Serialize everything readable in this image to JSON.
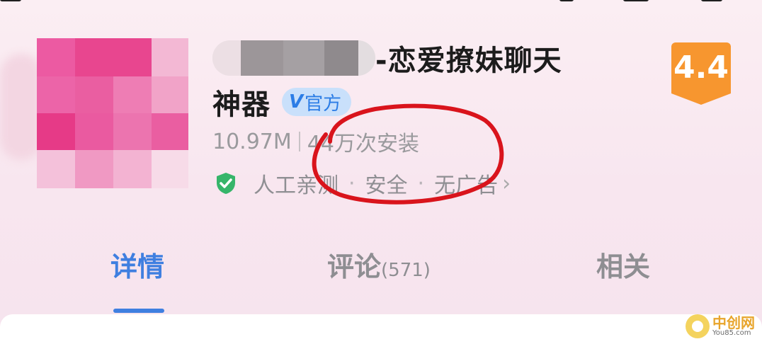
{
  "app": {
    "name_line1": "-恋爱撩妹聊天",
    "name_line2": "神器",
    "official_badge": "官方",
    "official_badge_mark": "V",
    "rating": "4.4",
    "size": "10.97M",
    "installs": "44万次安装",
    "safety_items": [
      "人工亲测",
      "安全",
      "无广告"
    ],
    "safety_separator": "·",
    "chevron": "›"
  },
  "tabs": [
    {
      "label": "详情",
      "count": "",
      "active": true
    },
    {
      "label": "评论",
      "count": "(571)",
      "active": false
    },
    {
      "label": "相关",
      "count": "",
      "active": false
    }
  ],
  "watermark": {
    "cn": "中创网",
    "en": "You85.com"
  },
  "icons": {
    "shield": "shield-check-icon",
    "chevron": "chevron-right-icon",
    "verified": "verified-v-icon"
  },
  "colors": {
    "accent_blue": "#3f7fe0",
    "rating_orange": "#f7962f",
    "safety_green": "#36b56a",
    "annotation_red": "#d9141c"
  }
}
